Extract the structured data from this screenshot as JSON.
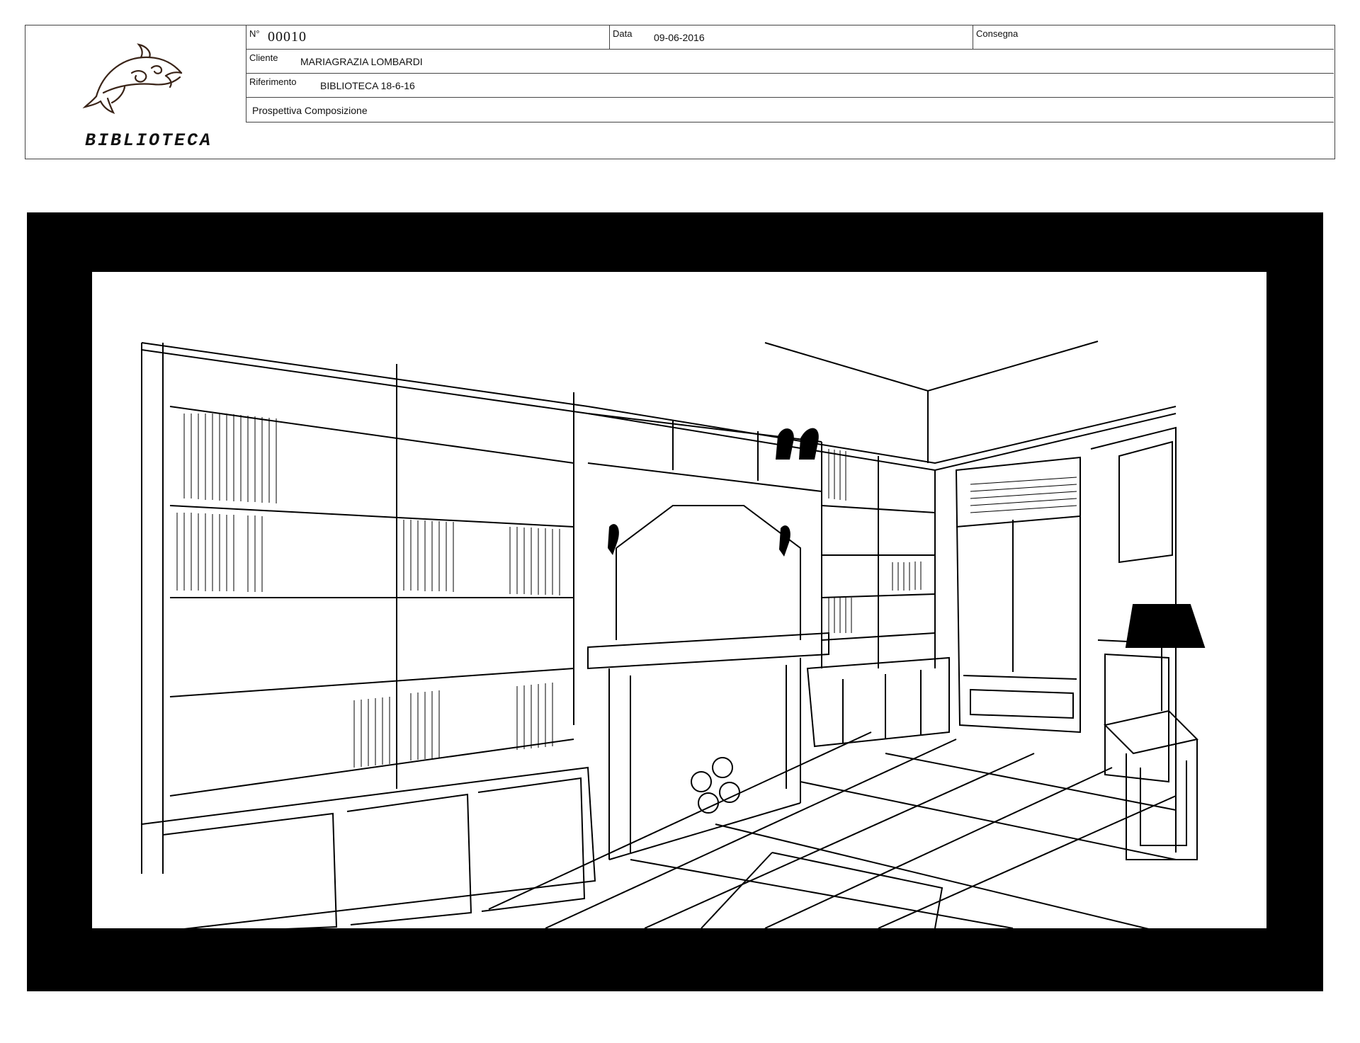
{
  "header": {
    "number_label": "N°",
    "number_value": "00010",
    "date_label": "Data",
    "date_value": "09-06-2016",
    "delivery_label": "Consegna",
    "delivery_value": "",
    "client_label": "Cliente",
    "client_value": "MARIAGRAZIA LOMBARDI",
    "reference_label": "Riferimento",
    "reference_value": "BIBLIOTECA 18-6-16",
    "view_description": "Prospettiva Composizione",
    "project_title": "BIBLIOTECA"
  },
  "logo": {
    "icon": "dolphin-logo-icon"
  },
  "drawing": {
    "subject": "line-drawing-library-perspective",
    "frame_color": "#000000",
    "paper_color": "#ffffff"
  }
}
